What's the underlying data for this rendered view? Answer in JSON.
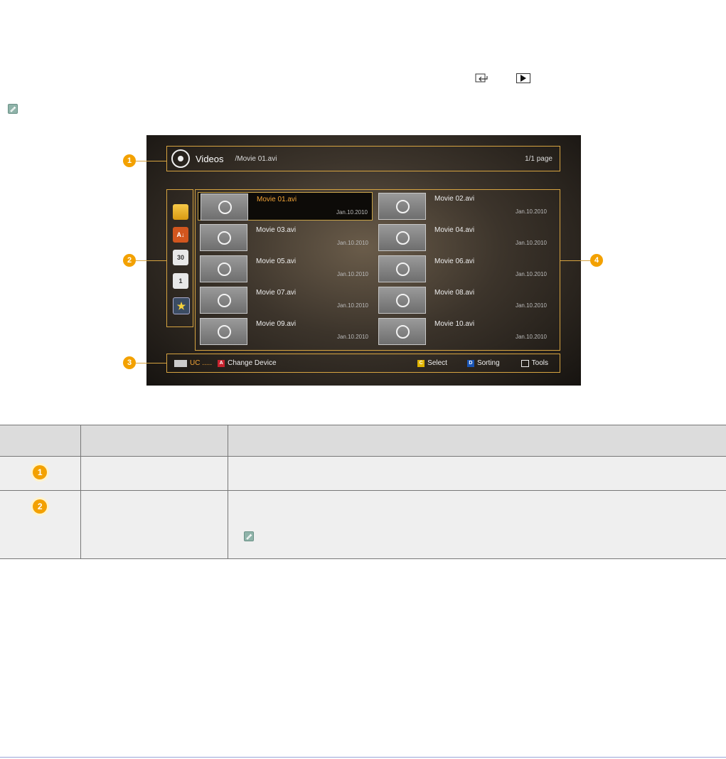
{
  "screen": {
    "title": "Videos",
    "path": "/Movie 01.avi",
    "page": "1/1 page",
    "items": [
      {
        "name": "Movie 01.avi",
        "date": "Jan.10.2010",
        "selected": true
      },
      {
        "name": "Movie 02.avi",
        "date": "Jan.10.2010"
      },
      {
        "name": "Movie 03.avi",
        "date": "Jan.10.2010"
      },
      {
        "name": "Movie 04.avi",
        "date": "Jan.10.2010"
      },
      {
        "name": "Movie 05.avi",
        "date": "Jan.10.2010"
      },
      {
        "name": "Movie 06.avi",
        "date": "Jan.10.2010"
      },
      {
        "name": "Movie 07.avi",
        "date": "Jan.10.2010"
      },
      {
        "name": "Movie 08.avi",
        "date": "Jan.10.2010"
      },
      {
        "name": "Movie 09.avi",
        "date": "Jan.10.2010"
      },
      {
        "name": "Movie 10.avi",
        "date": "Jan.10.2010"
      }
    ],
    "sidebar_icons": [
      "folder-icon",
      "az-sort-icon",
      "calendar-30-icon",
      "calendar-1-icon",
      "favorites-star-icon"
    ],
    "footer": {
      "device": "UC .....",
      "change_device_key": "A",
      "change_device": "Change Device",
      "select_key": "C",
      "select": "Select",
      "sorting_key": "D",
      "sorting": "Sorting",
      "tools": "Tools"
    }
  },
  "callouts": [
    "1",
    "2",
    "3",
    "4"
  ],
  "table": {
    "rows": [
      {
        "badge": "1"
      },
      {
        "badge": "2"
      }
    ]
  },
  "colors": {
    "accent": "#f3a100",
    "frame": "#d7a441",
    "key_a": "#c8242f",
    "key_c": "#e0b400",
    "key_d": "#1a55b5"
  }
}
